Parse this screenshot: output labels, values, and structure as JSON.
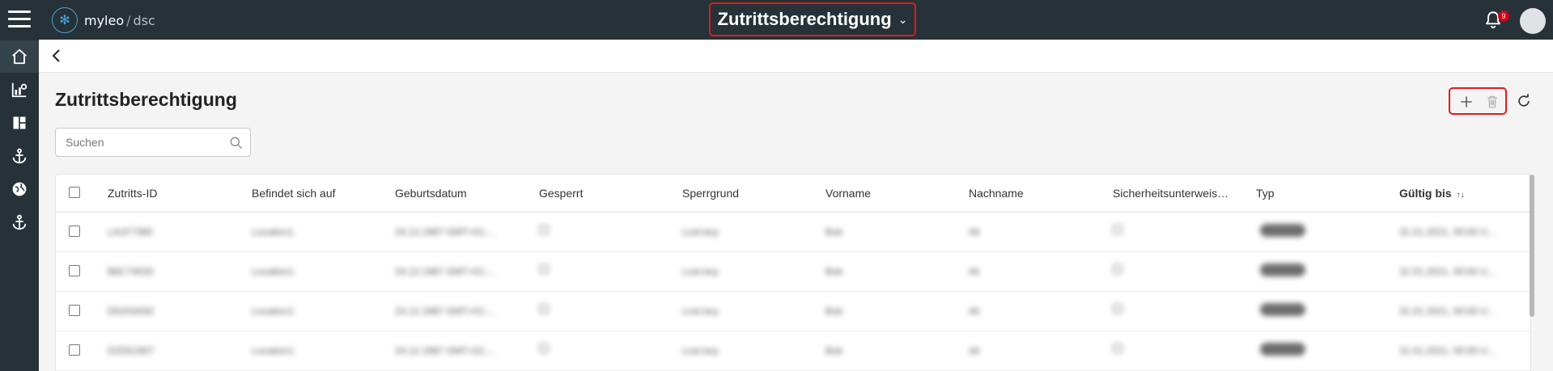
{
  "app": {
    "logo_name": "myleo",
    "logo_separator": "/",
    "logo_sub": "dsc"
  },
  "header": {
    "module_title": "Zutrittsberechtigung",
    "notification_count": "9"
  },
  "sidebar": {
    "items": [
      {
        "icon": "home-icon"
      },
      {
        "icon": "analytics-icon"
      },
      {
        "icon": "dashboard-icon"
      },
      {
        "icon": "anchor-icon"
      },
      {
        "icon": "globe-icon"
      },
      {
        "icon": "anchor-icon"
      }
    ]
  },
  "page": {
    "title": "Zutrittsberechtigung"
  },
  "toolbar": {
    "add_icon": "plus-icon",
    "delete_icon": "trash-icon",
    "refresh_icon": "refresh-icon"
  },
  "search": {
    "placeholder": "Suchen",
    "value": ""
  },
  "table": {
    "columns": [
      "Zutritts-ID",
      "Befindet sich auf",
      "Geburtsdatum",
      "Gesperrt",
      "Sperrgrund",
      "Vorname",
      "Nachname",
      "Sicherheitsunterweis…",
      "Typ",
      "Gültig bis"
    ],
    "sorted_column": "Gültig bis",
    "rows": [
      {
        "id": "LA1F7380",
        "location": "Location1",
        "dob": "24.12.1987 GMT+01:...",
        "reason": "Lost key",
        "first": "Bob",
        "last": "Ali",
        "type": "ARBEIT",
        "valid": "31.01.2021, 00:00 U..."
      },
      {
        "id": "B6C74020",
        "location": "Location1",
        "dob": "24.12.1987 GMT+01:...",
        "reason": "Lost key",
        "first": "Bob",
        "last": "Ali",
        "type": "ARBEIT",
        "valid": "31.01.2021, 00:00 U..."
      },
      {
        "id": "D5203A50",
        "location": "Location1",
        "dob": "24.12.1987 GMT+01:...",
        "reason": "Lost key",
        "first": "Bob",
        "last": "Ali",
        "type": "ARBEIT",
        "valid": "31.01.2021, 00:00 U..."
      },
      {
        "id": "D2D51907",
        "location": "Location1",
        "dob": "24.12.1987 GMT+01:...",
        "reason": "Lost key",
        "first": "Bob",
        "last": "Ali",
        "type": "ARBEIT",
        "valid": "31.01.2021, 00:00 U..."
      }
    ]
  },
  "colors": {
    "topbar": "#263238",
    "highlight": "#e01b1b",
    "badge": "#d0021b"
  }
}
